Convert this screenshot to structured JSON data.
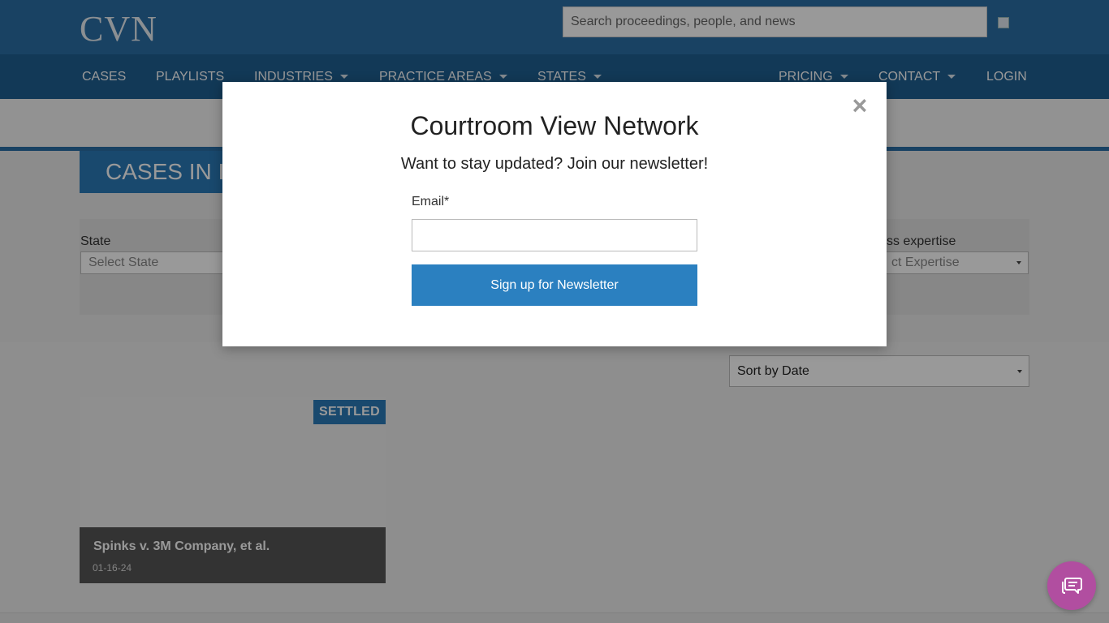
{
  "header": {
    "logo": "CVN",
    "search_placeholder": "Search proceedings, people, and news"
  },
  "nav": {
    "cases": "CASES",
    "playlists": "PLAYLISTS",
    "industries": "INDUSTRIES",
    "practice_areas": "PRACTICE AREAS",
    "states": "STATES",
    "pricing": "PRICING",
    "contact": "CONTACT",
    "login": "LOGIN"
  },
  "page": {
    "title": "CASES IN I"
  },
  "filters": {
    "state_label": "State",
    "state_placeholder": "Select State",
    "expertise_label": "ss expertise",
    "expertise_placeholder": "ct Expertise"
  },
  "sort": {
    "selected": "Sort by Date"
  },
  "cases": [
    {
      "status": "SETTLED",
      "title": "Spinks v. 3M Company, et al.",
      "date": "01-16-24"
    }
  ],
  "modal": {
    "close": "×",
    "title": "Courtroom View Network",
    "subtitle": "Want to stay updated? Join our newsletter!",
    "email_label": "Email*",
    "email_value": "",
    "submit_label": "Sign up for Newsletter"
  },
  "colors": {
    "header_bg": "#2b6fa6",
    "nav_bg": "#1f5f92",
    "accent": "#2b80c0",
    "chat_button": "#b14ea0"
  },
  "icons": {
    "close": "close-icon",
    "chat": "chat-bubble-icon",
    "dropdown": "chevron-down-icon"
  }
}
